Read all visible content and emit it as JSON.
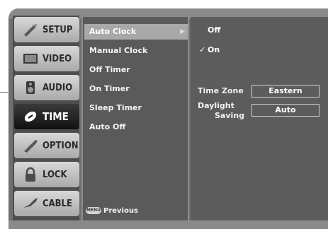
{
  "nav": {
    "items": [
      {
        "label": "SETUP",
        "icon": "wrench-icon"
      },
      {
        "label": "VIDEO",
        "icon": "screen-icon"
      },
      {
        "label": "AUDIO",
        "icon": "speaker-icon"
      },
      {
        "label": "TIME",
        "icon": "clock-icon",
        "active": true
      },
      {
        "label": "OPTION",
        "icon": "tools-icon"
      },
      {
        "label": "LOCK",
        "icon": "padlock-icon"
      },
      {
        "label": "CABLE",
        "icon": "cable-icon"
      }
    ]
  },
  "menu": {
    "items": [
      {
        "label": "Auto Clock",
        "selected": true,
        "arrow": "▶"
      },
      {
        "label": "Manual Clock"
      },
      {
        "label": "Off Timer"
      },
      {
        "label": "On Timer"
      },
      {
        "label": "Sleep Timer"
      },
      {
        "label": "Auto Off"
      }
    ],
    "footer_key": "MENU",
    "footer_label": "Previous"
  },
  "panel": {
    "options": [
      {
        "label": "Off",
        "checked": false
      },
      {
        "label": "On",
        "checked": true
      }
    ],
    "check_mark": "✓",
    "time_zone_label": "Time Zone",
    "time_zone_value": "Eastern",
    "daylight_label_1": "Daylight",
    "daylight_label_2": "Saving",
    "daylight_value": "Auto"
  },
  "colors": {
    "background": "#6f6f6f",
    "nav_inactive": "#bdbdbd",
    "nav_active": "#111111",
    "menu_selected": "#a8a8a8"
  }
}
